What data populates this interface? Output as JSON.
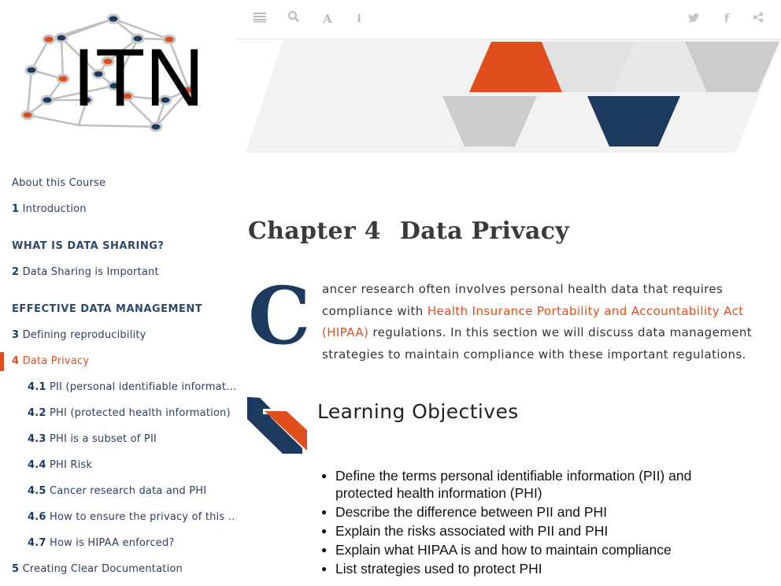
{
  "logo": {
    "text": "ITN"
  },
  "toolbar": {
    "left_icons": [
      "menu-icon",
      "search-icon",
      "font-icon",
      "info-icon"
    ],
    "right_icons": [
      "twitter-icon",
      "facebook-icon",
      "share-icon"
    ]
  },
  "toc": [
    {
      "num": "",
      "label": "About this Course",
      "kind": "item"
    },
    {
      "num": "1",
      "label": "Introduction",
      "kind": "item"
    },
    {
      "num": "",
      "label": "WHAT IS DATA SHARING?",
      "kind": "header"
    },
    {
      "num": "2",
      "label": "Data Sharing is Important",
      "kind": "item"
    },
    {
      "num": "",
      "label": "EFFECTIVE DATA MANAGEMENT",
      "kind": "header"
    },
    {
      "num": "3",
      "label": "Defining reproducibility",
      "kind": "item"
    },
    {
      "num": "4",
      "label": "Data Privacy",
      "kind": "active"
    },
    {
      "num": "4.1",
      "label": "PII (personal identifiable informat...",
      "kind": "sub"
    },
    {
      "num": "4.2",
      "label": "PHI (protected health information)",
      "kind": "sub"
    },
    {
      "num": "4.3",
      "label": "PHI is a subset of PII",
      "kind": "sub"
    },
    {
      "num": "4.4",
      "label": "PHI Risk",
      "kind": "sub"
    },
    {
      "num": "4.5",
      "label": "Cancer research data and PHI",
      "kind": "sub"
    },
    {
      "num": "4.6",
      "label": "How to ensure the privacy of this i...",
      "kind": "sub"
    },
    {
      "num": "4.7",
      "label": "How is HIPAA enforced?",
      "kind": "sub"
    },
    {
      "num": "5",
      "label": "Creating Clear Documentation",
      "kind": "item"
    }
  ],
  "chapter": {
    "label": "Chapter 4",
    "title": "Data Privacy"
  },
  "intro": {
    "dropcap": "C",
    "text_before": "ancer research often involves personal health data that requires compliance with ",
    "link": "Health Insurance Portability and Accountability Act (HIPAA)",
    "text_after": " regulations. In this section we will discuss data management strategies to maintain compliance with these important regulations."
  },
  "learning_objectives": {
    "title": "Learning Objectives",
    "items": [
      "Define the terms personal identifiable information (PII) and protected health information (PHI)",
      "Describe the difference between PII and PHI",
      "Explain the risks associated with PII and PHI",
      "Explain what HIPAA is and how to maintain compliance",
      "List strategies used to protect PHI"
    ]
  },
  "colors": {
    "accent": "#e04e1d",
    "navy": "#1b3a5e",
    "grey": "#cccccc",
    "light_grey": "#e6e6e6"
  }
}
